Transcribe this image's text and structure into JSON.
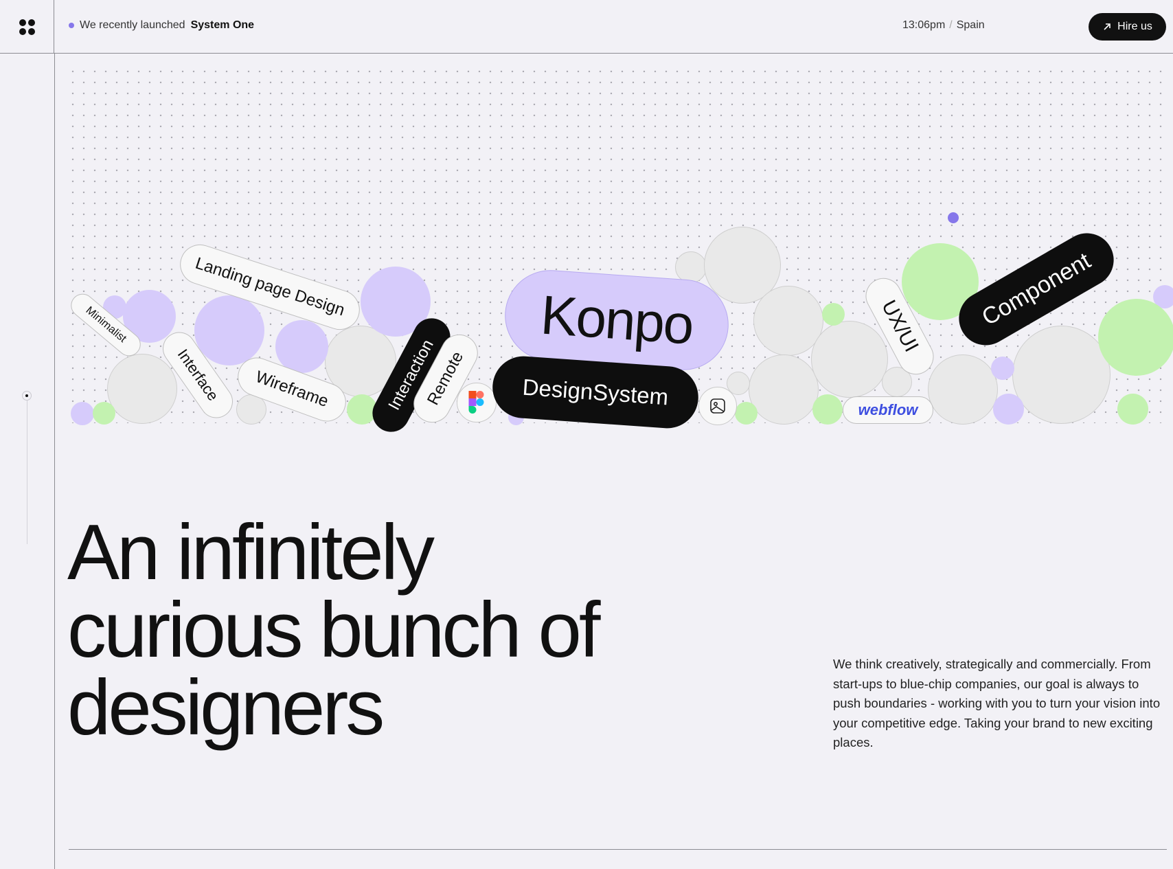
{
  "header": {
    "announcement_prefix": "We recently launched",
    "announcement_product": "System One",
    "time": "13:06pm",
    "time_separator": "/",
    "location": "Spain",
    "hire_label": "Hire us",
    "hire_icon": "arrow-up-right-icon"
  },
  "tags": {
    "minimalist": "Minimalist",
    "landing": "Landing page Design",
    "interface": "Interface",
    "wireframe": "Wireframe",
    "interaction": "Interaction",
    "remote": "Remote",
    "konpo": "Konpo",
    "design_system": "DesignSystem",
    "uxui": "UX/UI",
    "component": "Component",
    "webflow": "webflow"
  },
  "hero": {
    "headline_line1": "An infinitely",
    "headline_line2": "curious bunch of",
    "headline_line3": "designers",
    "intro": "We think creatively, strategically and commercially. From start-ups to blue-chip companies, our goal is always to push boundaries - working with you to turn your vision into your competitive edge. Taking your brand to new exciting places."
  },
  "colors": {
    "background": "#f2f1f6",
    "lavender": "#d6cbfb",
    "lime": "#c3f2b0",
    "accent_dot": "#8677ea",
    "ink": "#111111"
  }
}
